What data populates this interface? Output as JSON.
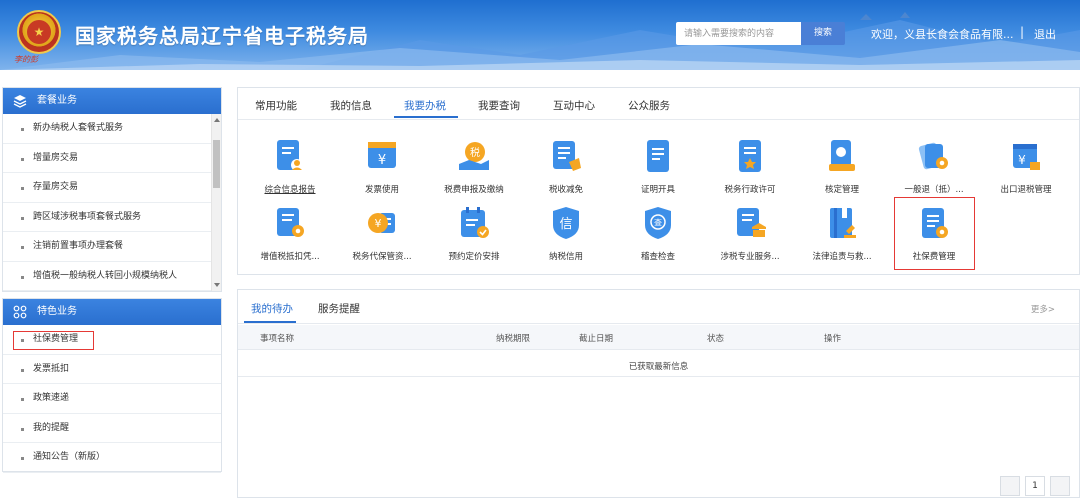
{
  "header": {
    "site_title": "国家税务总局辽宁省电子税务局",
    "emblem_signature": "李的彭",
    "search_placeholder": "请输入需要搜索的内容",
    "search_label": "搜索",
    "welcome": "欢迎，义县长食会食品有限...",
    "separator": "|",
    "logout": "退出"
  },
  "sidebar": {
    "package": {
      "title": "套餐业务",
      "items": [
        {
          "label": "新办纳税人套餐式服务"
        },
        {
          "label": "增量房交易"
        },
        {
          "label": "存量房交易"
        },
        {
          "label": "跨区域涉税事项套餐式服务"
        },
        {
          "label": "注销前置事项办理套餐"
        },
        {
          "label": "增值税一般纳税人转回小规模纳税人"
        }
      ]
    },
    "special": {
      "title": "特色业务",
      "items": [
        {
          "label": "社保费管理"
        },
        {
          "label": "发票抵扣"
        },
        {
          "label": "政策速递"
        },
        {
          "label": "我的提醒"
        },
        {
          "label": "通知公告（新版）"
        }
      ]
    }
  },
  "main": {
    "tabs": [
      "常用功能",
      "我的信息",
      "我要办税",
      "我要查询",
      "互动中心",
      "公众服务"
    ],
    "active_tab": "我要办税",
    "services_row1": [
      {
        "label": "综合信息报告",
        "icon": "report-icon"
      },
      {
        "label": "发票使用",
        "icon": "invoice-icon"
      },
      {
        "label": "税费申报及缴纳",
        "icon": "tax-payment-icon"
      },
      {
        "label": "税收减免",
        "icon": "tax-reduction-icon"
      },
      {
        "label": "证明开具",
        "icon": "certificate-icon"
      },
      {
        "label": "税务行政许可",
        "icon": "license-icon"
      },
      {
        "label": "核定管理",
        "icon": "assessment-icon"
      },
      {
        "label": "一般退（抵）...",
        "icon": "refund-icon"
      },
      {
        "label": "出口退税管理",
        "icon": "export-refund-icon"
      }
    ],
    "services_row2": [
      {
        "label": "增值税抵扣凭...",
        "icon": "vat-deduction-icon"
      },
      {
        "label": "税务代保管资...",
        "icon": "custody-icon"
      },
      {
        "label": "预约定价安排",
        "icon": "pricing-icon"
      },
      {
        "label": "纳税信用",
        "icon": "credit-icon"
      },
      {
        "label": "稽查检查",
        "icon": "inspection-icon"
      },
      {
        "label": "涉税专业服务...",
        "icon": "professional-service-icon"
      },
      {
        "label": "法律追责与救...",
        "icon": "legal-icon"
      },
      {
        "label": "社保费管理",
        "icon": "social-security-icon"
      }
    ],
    "icon_glyphs": {
      "invoice": "¥",
      "tax_payment": "税",
      "credit": "信",
      "inspection": "查",
      "export_refund": "¥",
      "custody": "¥"
    }
  },
  "tasks": {
    "tabs": [
      "我的待办",
      "服务提醒"
    ],
    "more": "更多>",
    "columns": [
      "事项名称",
      "纳税期限",
      "截止日期",
      "状态",
      "操作"
    ],
    "empty_message": "已获取最新信息",
    "page": "1"
  },
  "colors": {
    "accent": "#2a6fcf",
    "icon_blue": "#3d8fe8",
    "icon_orange": "#f5a623",
    "highlight": "#e53935"
  }
}
